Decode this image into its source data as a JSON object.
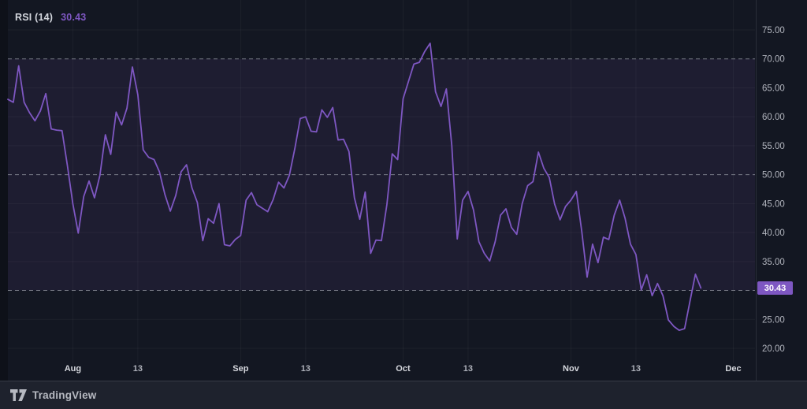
{
  "header": {
    "indicator_label": "RSI (14)",
    "value": "30.43"
  },
  "footer": {
    "brand": "TradingView"
  },
  "chart_data": {
    "type": "line",
    "title": "RSI (14)",
    "current_value": 30.43,
    "x_unit": "trading days (index along time axis)",
    "x_domain": [
      0,
      138
    ],
    "ylim_visible": [
      20,
      75
    ],
    "grid": true,
    "legend_position": "top-left",
    "y_ticks": [
      {
        "v": 75,
        "label": "75.00"
      },
      {
        "v": 70,
        "label": "70.00"
      },
      {
        "v": 65,
        "label": "65.00"
      },
      {
        "v": 60,
        "label": "60.00"
      },
      {
        "v": 55,
        "label": "55.00"
      },
      {
        "v": 50,
        "label": "50.00"
      },
      {
        "v": 45,
        "label": "45.00"
      },
      {
        "v": 40,
        "label": "40.00"
      },
      {
        "v": 35,
        "label": "35.00"
      },
      {
        "v": 25,
        "label": "25.00"
      },
      {
        "v": 20,
        "label": "20.00"
      }
    ],
    "x_ticks": [
      {
        "label": "Aug",
        "d": 12,
        "month": true
      },
      {
        "label": "13",
        "d": 24,
        "month": false
      },
      {
        "label": "Sep",
        "d": 43,
        "month": true
      },
      {
        "label": "13",
        "d": 55,
        "month": false
      },
      {
        "label": "Oct",
        "d": 73,
        "month": true
      },
      {
        "label": "13",
        "d": 85,
        "month": false
      },
      {
        "label": "Nov",
        "d": 104,
        "month": true
      },
      {
        "label": "13",
        "d": 116,
        "month": false
      },
      {
        "label": "Dec",
        "d": 134,
        "month": true
      }
    ],
    "limit_levels": [
      70,
      50,
      30
    ],
    "series": [
      {
        "name": "RSI (14)",
        "points": [
          [
            0,
            63
          ],
          [
            1,
            62.5
          ],
          [
            2,
            68.8
          ],
          [
            3,
            62.5
          ],
          [
            4,
            60.7
          ],
          [
            5,
            59.3
          ],
          [
            6,
            61
          ],
          [
            7,
            64
          ],
          [
            8,
            57.9
          ],
          [
            9,
            57.7
          ],
          [
            10,
            57.6
          ],
          [
            11,
            51.5
          ],
          [
            12,
            45
          ],
          [
            13,
            39.9
          ],
          [
            14,
            46.2
          ],
          [
            15,
            48.9
          ],
          [
            16,
            46
          ],
          [
            17,
            49.9
          ],
          [
            18,
            56.9
          ],
          [
            19,
            53.5
          ],
          [
            20,
            60.8
          ],
          [
            21,
            58.6
          ],
          [
            22,
            61.5
          ],
          [
            23,
            68.6
          ],
          [
            24,
            63.8
          ],
          [
            25,
            54.3
          ],
          [
            26,
            53
          ],
          [
            27,
            52.6
          ],
          [
            28,
            50.5
          ],
          [
            29,
            46.6
          ],
          [
            30,
            43.7
          ],
          [
            31,
            46.4
          ],
          [
            32,
            50.5
          ],
          [
            33,
            51.7
          ],
          [
            34,
            47.7
          ],
          [
            35,
            45.2
          ],
          [
            36,
            38.6
          ],
          [
            37,
            42.4
          ],
          [
            38,
            41.6
          ],
          [
            39,
            45
          ],
          [
            40,
            37.9
          ],
          [
            41,
            37.7
          ],
          [
            42,
            38.8
          ],
          [
            43,
            39.5
          ],
          [
            44,
            45.6
          ],
          [
            45,
            46.9
          ],
          [
            46,
            44.8
          ],
          [
            47,
            44.2
          ],
          [
            48,
            43.6
          ],
          [
            49,
            45.7
          ],
          [
            50,
            48.7
          ],
          [
            51,
            47.7
          ],
          [
            52,
            49.9
          ],
          [
            53,
            54.5
          ],
          [
            54,
            59.7
          ],
          [
            55,
            60
          ],
          [
            56,
            57.5
          ],
          [
            57,
            57.4
          ],
          [
            58,
            61.2
          ],
          [
            59,
            59.9
          ],
          [
            60,
            61.6
          ],
          [
            61,
            56
          ],
          [
            62,
            56.1
          ],
          [
            63,
            54
          ],
          [
            64,
            46
          ],
          [
            65,
            42.3
          ],
          [
            66,
            47
          ],
          [
            67,
            36.4
          ],
          [
            68,
            38.7
          ],
          [
            69,
            38.6
          ],
          [
            70,
            44.8
          ],
          [
            71,
            53.6
          ],
          [
            72,
            52.6
          ],
          [
            73,
            63.1
          ],
          [
            74,
            66.1
          ],
          [
            75,
            69.1
          ],
          [
            76,
            69.4
          ],
          [
            77,
            71.3
          ],
          [
            78,
            72.7
          ],
          [
            79,
            64.3
          ],
          [
            80,
            61.8
          ],
          [
            81,
            64.8
          ],
          [
            82,
            55
          ],
          [
            83,
            38.9
          ],
          [
            84,
            45.6
          ],
          [
            85,
            47.1
          ],
          [
            86,
            43.9
          ],
          [
            87,
            38.4
          ],
          [
            88,
            36.4
          ],
          [
            89,
            35.1
          ],
          [
            90,
            38.4
          ],
          [
            91,
            43
          ],
          [
            92,
            44.1
          ],
          [
            93,
            40.9
          ],
          [
            94,
            39.7
          ],
          [
            95,
            45
          ],
          [
            96,
            48.1
          ],
          [
            97,
            48.8
          ],
          [
            98,
            53.9
          ],
          [
            99,
            51.1
          ],
          [
            100,
            49.5
          ],
          [
            101,
            44.9
          ],
          [
            102,
            42.2
          ],
          [
            103,
            44.5
          ],
          [
            104,
            45.6
          ],
          [
            105,
            47.1
          ],
          [
            106,
            40.2
          ],
          [
            107,
            32.3
          ],
          [
            108,
            38
          ],
          [
            109,
            34.8
          ],
          [
            110,
            39.2
          ],
          [
            111,
            38.8
          ],
          [
            112,
            43
          ],
          [
            113,
            45.6
          ],
          [
            114,
            42.5
          ],
          [
            115,
            38
          ],
          [
            116,
            36.2
          ],
          [
            117,
            30.1
          ],
          [
            118,
            32.7
          ],
          [
            119,
            29.1
          ],
          [
            120,
            31.2
          ],
          [
            121,
            29.1
          ],
          [
            122,
            24.9
          ],
          [
            123,
            23.8
          ],
          [
            124,
            23.1
          ],
          [
            125,
            23.4
          ],
          [
            126,
            28.2
          ],
          [
            127,
            32.8
          ],
          [
            128,
            30.43
          ]
        ]
      }
    ],
    "colors": {
      "background": "#131722",
      "band_fill": "#1e1d31",
      "line": "#7e57c2",
      "limit_dashed": "#787b86",
      "grid": "rgba(255,255,255,0.045)",
      "badge_bg": "#7e57c2",
      "badge_text": "#ffffff",
      "axis_text": "#b2b5be"
    }
  }
}
